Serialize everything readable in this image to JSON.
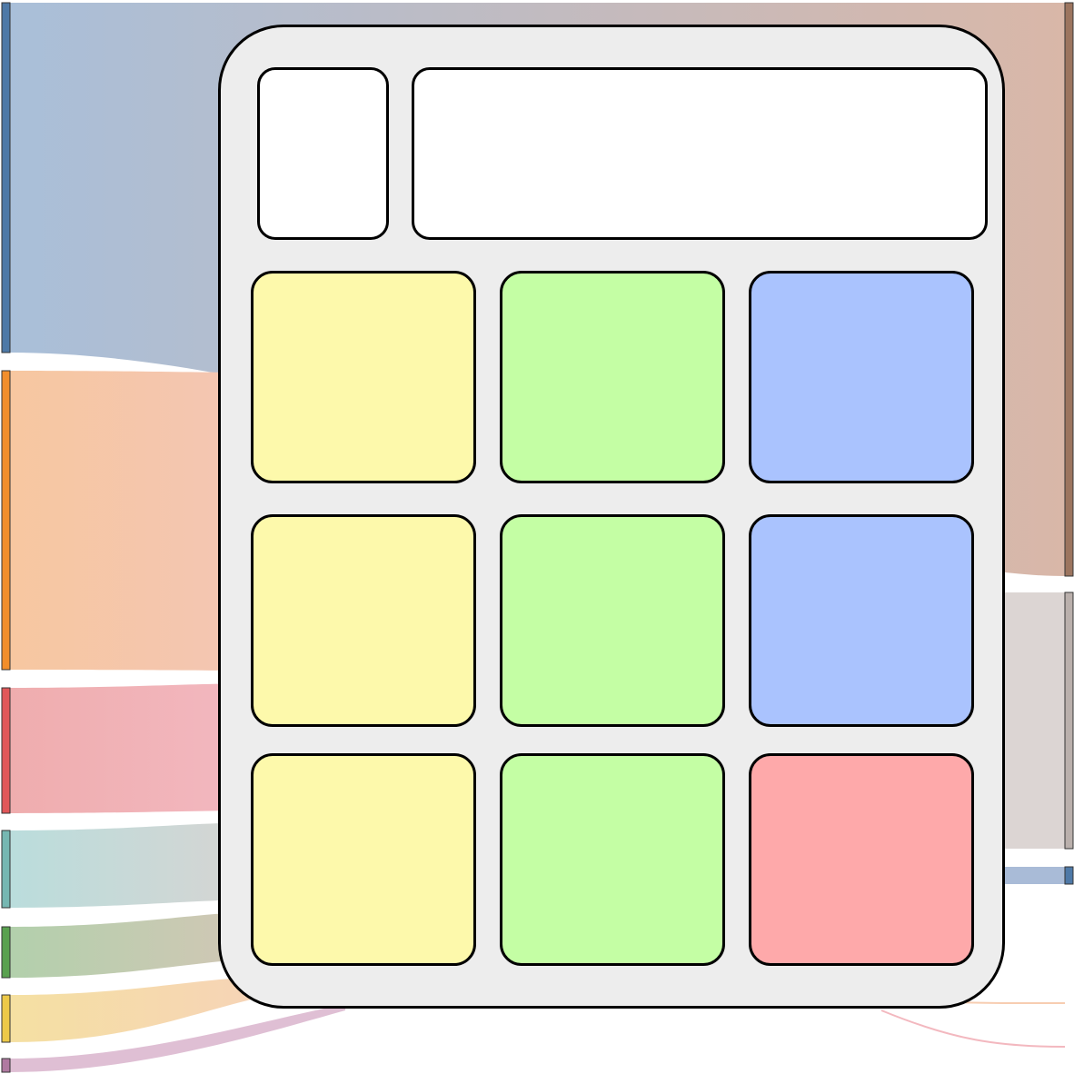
{
  "colors": {
    "background": "#ffffff",
    "calculator_body": "#ededed",
    "outline": "#000000",
    "display": "#ffffff",
    "key_yellow": "#fdf9ab",
    "key_green": "#c4fea4",
    "key_blue": "#aac3fe",
    "key_red": "#fea9aa"
  },
  "keys": [
    {
      "name": "key-r1-c1",
      "color": "#fdf9ab"
    },
    {
      "name": "key-r1-c2",
      "color": "#c4fea4"
    },
    {
      "name": "key-r1-c3",
      "color": "#aac3fe"
    },
    {
      "name": "key-r2-c1",
      "color": "#fdf9ab"
    },
    {
      "name": "key-r2-c2",
      "color": "#c4fea4"
    },
    {
      "name": "key-r2-c3",
      "color": "#aac3fe"
    },
    {
      "name": "key-r3-c1",
      "color": "#fdf9ab"
    },
    {
      "name": "key-r3-c2",
      "color": "#c4fea4"
    },
    {
      "name": "key-r3-c3",
      "color": "#fea9aa"
    }
  ],
  "sankey": {
    "source_nodes": [
      {
        "name": "source-node-1",
        "color": "#4e79a7"
      },
      {
        "name": "source-node-2",
        "color": "#f28e2b"
      },
      {
        "name": "source-node-3",
        "color": "#e15759"
      },
      {
        "name": "source-node-4",
        "color": "#76b7b2"
      },
      {
        "name": "source-node-5",
        "color": "#59a14f"
      },
      {
        "name": "source-node-6",
        "color": "#edc948"
      },
      {
        "name": "source-node-7",
        "color": "#b07aa1"
      }
    ],
    "target_nodes": [
      {
        "name": "target-node-1",
        "color": "#9c755f"
      },
      {
        "name": "target-node-2",
        "color": "#bab0ac"
      },
      {
        "name": "target-node-3",
        "color": "#4e79a7"
      }
    ]
  }
}
